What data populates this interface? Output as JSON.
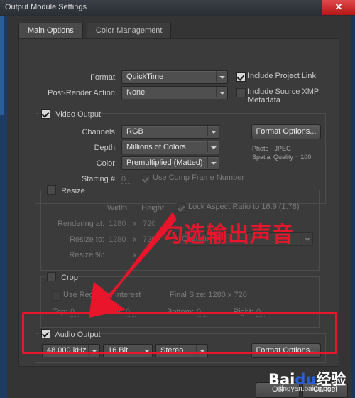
{
  "window": {
    "title": "Output Module Settings",
    "close_label": "✕"
  },
  "tabs": [
    {
      "label": "Main Options",
      "active": true
    },
    {
      "label": "Color Management",
      "active": false
    }
  ],
  "main_options": {
    "format_label": "Format:",
    "format_value": "QuickTime",
    "post_render_label": "Post-Render Action:",
    "post_render_value": "None",
    "include_project_link": {
      "label": "Include Project Link",
      "checked": true
    },
    "include_xmp": {
      "label": "Include Source XMP Metadata",
      "checked": false
    }
  },
  "video_output": {
    "group_label": "Video Output",
    "checked": true,
    "channels_label": "Channels:",
    "channels_value": "RGB",
    "depth_label": "Depth:",
    "depth_value": "Millions of Colors",
    "color_label": "Color:",
    "color_value": "Premultiplied (Matted)",
    "starting_label": "Starting #:",
    "starting_value": "0",
    "use_comp_frame_number": {
      "label": "Use Comp Frame Number",
      "checked": true
    },
    "format_options_button": "Format Options...",
    "codec_info_line1": "Photo - JPEG",
    "codec_info_line2": "Spatial Quality = 100"
  },
  "resize": {
    "group_label": "Resize",
    "checked": false,
    "width_label": "Width",
    "height_label": "Height",
    "lock_aspect_label": "Lock Aspect Ratio to 16:9 (1.78)",
    "lock_aspect_checked": true,
    "rendering_at_label": "Rendering at:",
    "rendering_width": "1280",
    "rendering_height": "720",
    "resize_to_label": "Resize to:",
    "resize_width": "1280",
    "resize_height": "720",
    "resize_quality_value": "Custom",
    "resize_pct_label": "Resize %:",
    "x_separator": "x"
  },
  "crop": {
    "group_label": "Crop",
    "checked": false,
    "use_region_label": "Use Region of Interest",
    "final_size_label": "Final Size: 1280 x 720",
    "top_label": "Top:",
    "top_value": "0",
    "left_label": "Left:",
    "left_value": "0",
    "bottom_label": "Bottom:",
    "bottom_value": "0",
    "right_label": "Right:",
    "right_value": "0"
  },
  "audio_output": {
    "group_label": "Audio Output",
    "checked": true,
    "sample_rate": "48.000 kHz",
    "bit_depth": "16 Bit",
    "channels": "Stereo",
    "format_options_button": "Format Options..."
  },
  "footer": {
    "ok_label": "OK",
    "cancel_label": "Cancel"
  },
  "annotation": {
    "text": "勾选输出声音",
    "color": "#e8152b"
  },
  "watermark": {
    "brand_prefix": "Bai",
    "brand_mid": "du",
    "brand_suffix": "经验",
    "url": "jingyan.baidu.com"
  }
}
